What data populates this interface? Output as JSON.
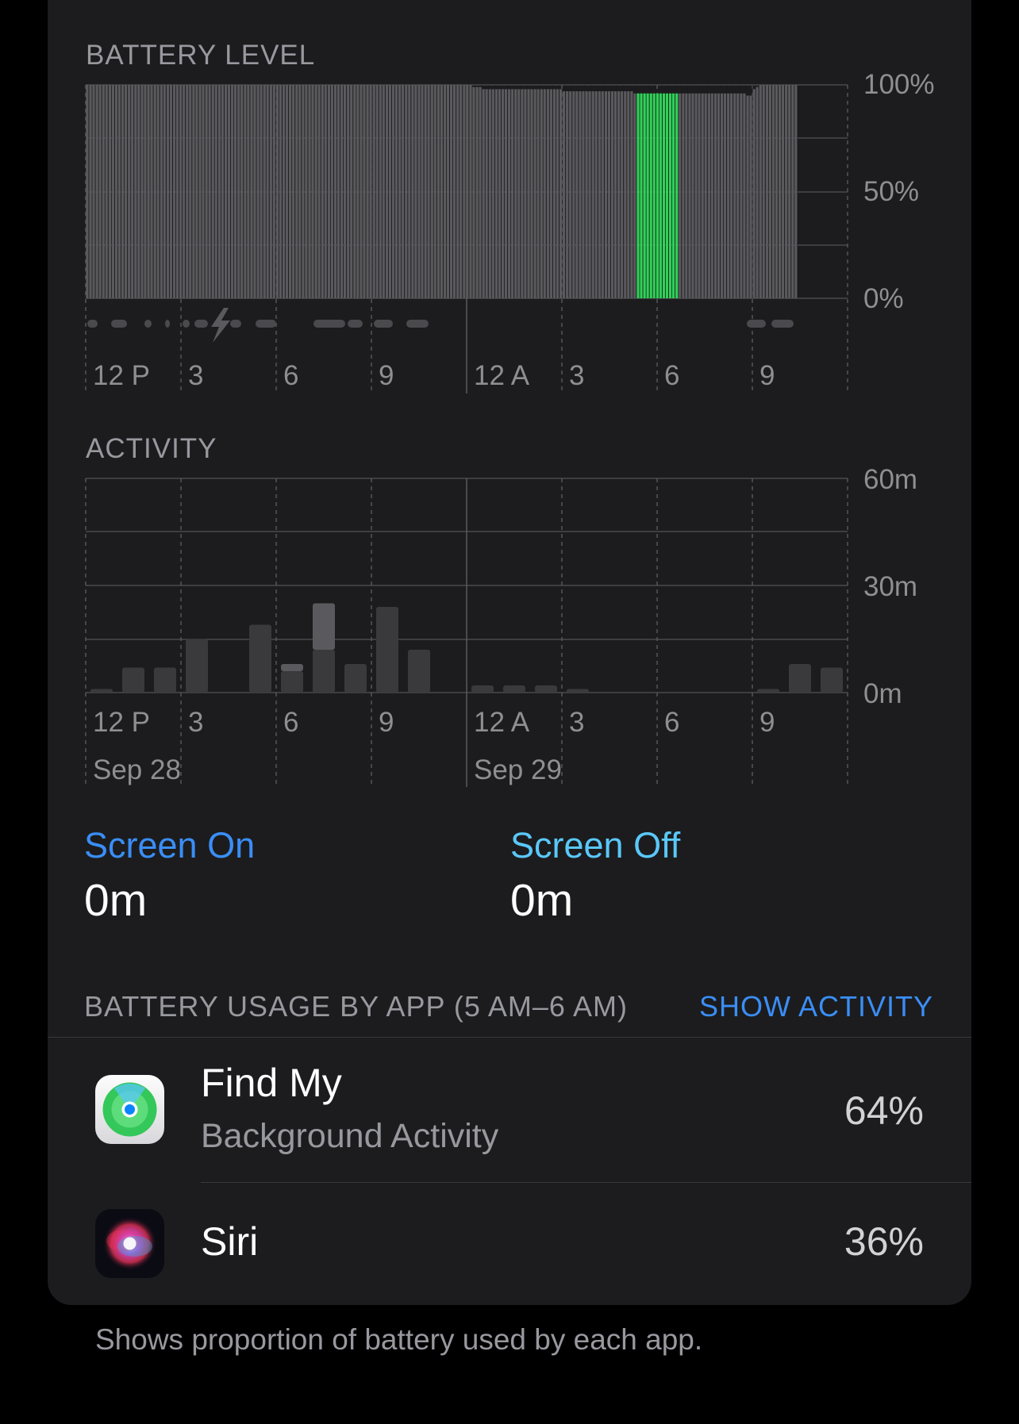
{
  "battery_section": {
    "title": "BATTERY LEVEL",
    "y_ticks": [
      "100%",
      "50%",
      "0%"
    ],
    "x_ticks": [
      "12 P",
      "3",
      "6",
      "9",
      "12 A",
      "3",
      "6",
      "9"
    ]
  },
  "activity_section": {
    "title": "ACTIVITY",
    "y_ticks": [
      "60m",
      "30m",
      "0m"
    ],
    "x_ticks": [
      "12 P",
      "3",
      "6",
      "9",
      "12 A",
      "3",
      "6",
      "9"
    ],
    "dates": [
      "Sep 28",
      "Sep 29"
    ]
  },
  "chart_data": [
    {
      "type": "bar",
      "title": "BATTERY LEVEL",
      "ylim": [
        0,
        100
      ],
      "y_ticks": [
        "100%",
        "50%",
        "0%"
      ],
      "x_ticks": [
        "12 P",
        "3",
        "6",
        "9",
        "12 A",
        "3",
        "6",
        "9"
      ],
      "highlight_color": "#30d158",
      "base_color": "#5a5a5e",
      "values": [
        100,
        100,
        100,
        100,
        100,
        100,
        100,
        100,
        100,
        100,
        100,
        100,
        100,
        100,
        100,
        100,
        100,
        100,
        100,
        100,
        100,
        100,
        100,
        100,
        100,
        100,
        100,
        100,
        100,
        100,
        100,
        100,
        100,
        100,
        100,
        100,
        100,
        100,
        100,
        100,
        100,
        100,
        100,
        100,
        100,
        100,
        100,
        100,
        100,
        100,
        100,
        100,
        100,
        100,
        100,
        100,
        100,
        100,
        100,
        100,
        100,
        100,
        100,
        100,
        100,
        100,
        100,
        100,
        100,
        100,
        100,
        100,
        100,
        100,
        100,
        100,
        100,
        100,
        100,
        100,
        100,
        100,
        100,
        100,
        100,
        100,
        100,
        100,
        100,
        100,
        100,
        100,
        100,
        100,
        100,
        100,
        100,
        100,
        100,
        100,
        100,
        100,
        100,
        100,
        100,
        100,
        100,
        100,
        100,
        100,
        100,
        100,
        100,
        100,
        100,
        100,
        100,
        100,
        100,
        100,
        99,
        99,
        99,
        98,
        98,
        98,
        98,
        98,
        98,
        98,
        98,
        98,
        98,
        98,
        98,
        98,
        98,
        98,
        98,
        98,
        98,
        98,
        98,
        98,
        98,
        98,
        98,
        98,
        97,
        97,
        97,
        97,
        97,
        97,
        97,
        97,
        97,
        97,
        97,
        97,
        97,
        97,
        97,
        97,
        97,
        97,
        97,
        97,
        97,
        97,
        96,
        96,
        96,
        96,
        96,
        96,
        96,
        96,
        96,
        96,
        96,
        96,
        96,
        96,
        96,
        96,
        96,
        96,
        96,
        96,
        96,
        96,
        96,
        96,
        96,
        96,
        96,
        96,
        96,
        96,
        96,
        96,
        96,
        96,
        96,
        95,
        95,
        98,
        99,
        100,
        100,
        100,
        100,
        100,
        100,
        100,
        100,
        100,
        100,
        100,
        100
      ],
      "highlight_indices": [
        171,
        172,
        173,
        174,
        175,
        176,
        177,
        178,
        179,
        180,
        181,
        182,
        183
      ]
    },
    {
      "type": "bar",
      "title": "ACTIVITY",
      "ylim": [
        0,
        60
      ],
      "y_ticks": [
        "60m",
        "30m",
        "0m"
      ],
      "x_ticks": [
        "12 P",
        "3",
        "6",
        "9",
        "12 A",
        "3",
        "6",
        "9"
      ],
      "x_dates": [
        "Sep 28",
        "Sep 29"
      ],
      "categories": [
        "12 P",
        "1",
        "2",
        "3",
        "4",
        "5",
        "6",
        "7",
        "8",
        "9",
        "10",
        "11",
        "12 A",
        "1",
        "2",
        "3",
        "4",
        "5",
        "6",
        "7",
        "8",
        "9",
        "10",
        "11"
      ],
      "series": [
        {
          "values": [
            1,
            0,
            0,
            0,
            0,
            0,
            0,
            0,
            0,
            0,
            0,
            0,
            2,
            2,
            2,
            1,
            0,
            0,
            0,
            0,
            0,
            0,
            0,
            0
          ],
          "color": "#3a3a3c"
        },
        {
          "values": [
            0,
            7,
            7,
            15,
            0,
            19,
            6,
            12,
            8,
            24,
            12,
            0,
            0,
            0,
            0,
            0,
            0,
            0,
            0,
            0,
            0,
            1,
            8,
            7
          ],
          "color": "#3a3a3c"
        },
        {
          "values": [
            0,
            0,
            0,
            0,
            0,
            0,
            2,
            13,
            0,
            0,
            0,
            0,
            0,
            0,
            0,
            0,
            0,
            0,
            0,
            0,
            0,
            0,
            0,
            0
          ],
          "color": "#5a5a5e"
        }
      ]
    }
  ],
  "screen_on": {
    "label": "Screen On",
    "value": "0m"
  },
  "screen_off": {
    "label": "Screen Off",
    "value": "0m"
  },
  "usage": {
    "header": "BATTERY USAGE BY APP (5 AM–6 AM)",
    "show_activity": "SHOW ACTIVITY",
    "apps": [
      {
        "name": "Find My",
        "subtitle": "Background Activity",
        "percent": "64%"
      },
      {
        "name": "Siri",
        "percent": "36%"
      }
    ]
  },
  "footer": "Shows proportion of battery used by each app."
}
